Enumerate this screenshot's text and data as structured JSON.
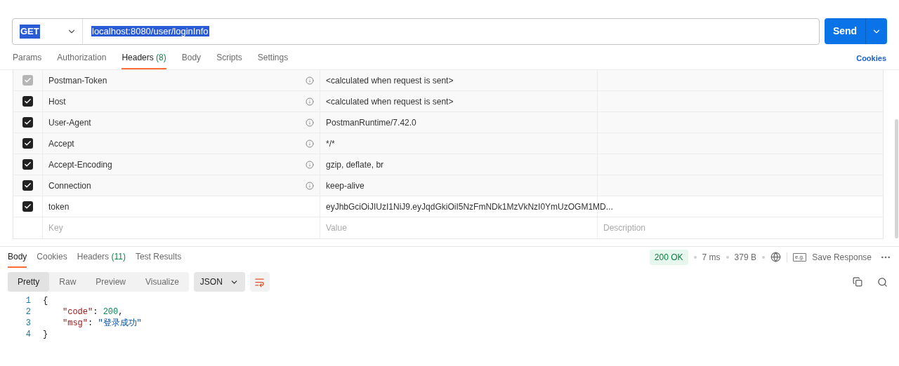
{
  "request": {
    "method": "GET",
    "url": "localhost:8080/user/loginInfo",
    "send": "Send"
  },
  "request_tabs": [
    {
      "label": "Params",
      "selected": false
    },
    {
      "label": "Authorization",
      "selected": false
    },
    {
      "label": "Headers",
      "count": "(8)",
      "selected": true
    },
    {
      "label": "Body",
      "selected": false
    },
    {
      "label": "Scripts",
      "selected": false
    },
    {
      "label": "Settings",
      "selected": false
    }
  ],
  "cookies_link": "Cookies",
  "headers": [
    {
      "key": "Postman-Token",
      "value": "<calculated when request is sent>",
      "checked": true,
      "disabled": true,
      "auto": true
    },
    {
      "key": "Host",
      "value": "<calculated when request is sent>",
      "checked": true,
      "disabled": false,
      "auto": true
    },
    {
      "key": "User-Agent",
      "value": "PostmanRuntime/7.42.0",
      "checked": true,
      "disabled": false,
      "auto": true
    },
    {
      "key": "Accept",
      "value": "*/*",
      "checked": true,
      "disabled": false,
      "auto": true
    },
    {
      "key": "Accept-Encoding",
      "value": "gzip, deflate, br",
      "checked": true,
      "disabled": false,
      "auto": true
    },
    {
      "key": "Connection",
      "value": "keep-alive",
      "checked": true,
      "disabled": false,
      "auto": true
    },
    {
      "key": "token",
      "value": "eyJhbGciOiJIUzI1NiJ9.eyJqdGkiOiI5NzFmNDk1MzVkNzI0YmUzOGM1MD...",
      "checked": true,
      "disabled": false,
      "auto": false
    }
  ],
  "new_header": {
    "key_placeholder": "Key",
    "value_placeholder": "Value",
    "description_placeholder": "Description"
  },
  "response_tabs": [
    {
      "label": "Body",
      "selected": true
    },
    {
      "label": "Cookies",
      "selected": false
    },
    {
      "label": "Headers",
      "count": "(11)",
      "selected": false
    },
    {
      "label": "Test Results",
      "selected": false
    }
  ],
  "status": {
    "code": "200 OK",
    "time": "7 ms",
    "size": "379 B",
    "save": "Save Response",
    "save_badge": "e.g."
  },
  "view_modes": [
    {
      "label": "Pretty",
      "selected": true
    },
    {
      "label": "Raw",
      "selected": false
    },
    {
      "label": "Preview",
      "selected": false
    },
    {
      "label": "Visualize",
      "selected": false
    }
  ],
  "format": "JSON",
  "code_lines": [
    {
      "number": "1",
      "tokens": [
        {
          "kind": "punct",
          "text": "{"
        }
      ]
    },
    {
      "number": "2",
      "tokens": [
        {
          "kind": "key",
          "text": "\"code\""
        },
        {
          "kind": "punct",
          "text": ": "
        },
        {
          "kind": "number",
          "text": "200"
        },
        {
          "kind": "punct",
          "text": ","
        }
      ]
    },
    {
      "number": "3",
      "tokens": [
        {
          "kind": "key",
          "text": "\"msg\""
        },
        {
          "kind": "punct",
          "text": ": "
        },
        {
          "kind": "string",
          "text": "\"登录成功\""
        }
      ]
    },
    {
      "number": "4",
      "tokens": [
        {
          "kind": "punct",
          "text": "}"
        }
      ]
    }
  ]
}
